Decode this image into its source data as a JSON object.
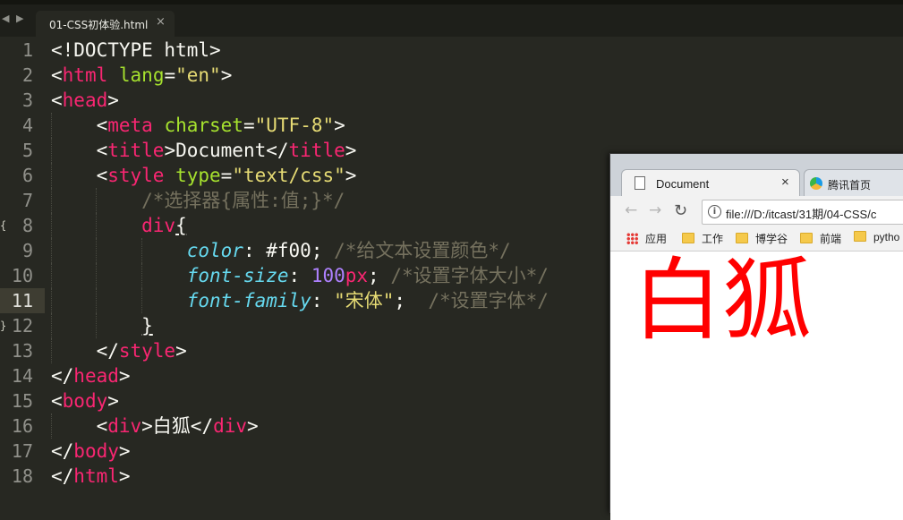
{
  "editor": {
    "tab_title": "01-CSS初体验.html",
    "nav_arrows": "◀ ▶",
    "close_glyph": "×",
    "lines": [
      {
        "n": "1",
        "tokens": [
          [
            "p0",
            "<!DOCTYPE html>"
          ]
        ]
      },
      {
        "n": "2",
        "tokens": [
          [
            "p0",
            "<"
          ],
          [
            "t",
            "html"
          ],
          [
            "p0",
            " "
          ],
          [
            "a",
            "lang"
          ],
          [
            "p0",
            "="
          ],
          [
            "s",
            "\"en\""
          ],
          [
            "p0",
            ">"
          ]
        ]
      },
      {
        "n": "3",
        "tokens": [
          [
            "p0",
            "<"
          ],
          [
            "t",
            "head"
          ],
          [
            "p0",
            ">"
          ]
        ]
      },
      {
        "n": "4",
        "tokens": [
          [
            "p0",
            "    <"
          ],
          [
            "t",
            "meta"
          ],
          [
            "p0",
            " "
          ],
          [
            "a",
            "charset"
          ],
          [
            "p0",
            "="
          ],
          [
            "s",
            "\"UTF-8\""
          ],
          [
            "p0",
            ">"
          ]
        ]
      },
      {
        "n": "5",
        "tokens": [
          [
            "p0",
            "    <"
          ],
          [
            "t",
            "title"
          ],
          [
            "p0",
            ">Document</"
          ],
          [
            "t",
            "title"
          ],
          [
            "p0",
            ">"
          ]
        ]
      },
      {
        "n": "6",
        "tokens": [
          [
            "p0",
            "    <"
          ],
          [
            "t",
            "style"
          ],
          [
            "p0",
            " "
          ],
          [
            "a",
            "type"
          ],
          [
            "p0",
            "="
          ],
          [
            "s",
            "\"text/css\""
          ],
          [
            "p0",
            ">"
          ]
        ]
      },
      {
        "n": "7",
        "tokens": [
          [
            "c",
            "        /*选择器{属性:值;}*/"
          ]
        ]
      },
      {
        "n": "8",
        "tokens": [
          [
            "t",
            "        div"
          ],
          [
            "u",
            "{"
          ]
        ]
      },
      {
        "n": "9",
        "tokens": [
          [
            "p0",
            "            "
          ],
          [
            "p",
            "color"
          ],
          [
            "p0",
            ": "
          ],
          [
            "p0",
            "#f00; "
          ],
          [
            "c",
            "/*给文本设置颜色*/"
          ]
        ]
      },
      {
        "n": "10",
        "tokens": [
          [
            "p0",
            "            "
          ],
          [
            "p",
            "font-size"
          ],
          [
            "p0",
            ": "
          ],
          [
            "n",
            "100"
          ],
          [
            "t",
            "px"
          ],
          [
            "p0",
            "; "
          ],
          [
            "c",
            "/*设置字体大小*/"
          ]
        ]
      },
      {
        "n": "11",
        "tokens": [
          [
            "p0",
            "            "
          ],
          [
            "p",
            "font-family"
          ],
          [
            "p0",
            ": "
          ],
          [
            "s",
            "\"宋体\""
          ],
          [
            "p0",
            ";  "
          ],
          [
            "c",
            "/*设置字体*/"
          ]
        ]
      },
      {
        "n": "12",
        "tokens": [
          [
            "p0",
            "        "
          ],
          [
            "u",
            "}"
          ]
        ]
      },
      {
        "n": "13",
        "tokens": [
          [
            "p0",
            "    </"
          ],
          [
            "t",
            "style"
          ],
          [
            "p0",
            ">"
          ]
        ]
      },
      {
        "n": "14",
        "tokens": [
          [
            "p0",
            "</"
          ],
          [
            "t",
            "head"
          ],
          [
            "p0",
            ">"
          ]
        ]
      },
      {
        "n": "15",
        "tokens": [
          [
            "p0",
            "<"
          ],
          [
            "t",
            "body"
          ],
          [
            "p0",
            ">"
          ]
        ]
      },
      {
        "n": "16",
        "tokens": [
          [
            "p0",
            "    <"
          ],
          [
            "t",
            "div"
          ],
          [
            "p0",
            ">白狐</"
          ],
          [
            "t",
            "div"
          ],
          [
            "p0",
            ">"
          ]
        ]
      },
      {
        "n": "17",
        "tokens": [
          [
            "p0",
            "</"
          ],
          [
            "t",
            "body"
          ],
          [
            "p0",
            ">"
          ]
        ]
      },
      {
        "n": "18",
        "tokens": [
          [
            "p0",
            "</"
          ],
          [
            "t",
            "html"
          ],
          [
            "p0",
            ">"
          ]
        ]
      }
    ]
  },
  "browser": {
    "tab_title": "Document",
    "tab_close": "×",
    "tab2_title": "腾讯首页",
    "back": "←",
    "forward": "→",
    "reload": "↻",
    "info_glyph": "i",
    "url": "file:///D:/itcast/31期/04-CSS/c",
    "bookmarks": [
      {
        "label": "应用",
        "kind": "apps"
      },
      {
        "label": "工作",
        "kind": "folder"
      },
      {
        "label": "博学谷",
        "kind": "folder"
      },
      {
        "label": "前端",
        "kind": "folder"
      },
      {
        "label": "pytho",
        "kind": "folder"
      }
    ],
    "page_text": "白狐",
    "page_text_color": "#ff0000"
  },
  "theme": {
    "background": "#272822",
    "tag": "#f92672",
    "attr": "#a6e22e",
    "string": "#e6db74",
    "property": "#66d9ef",
    "comment": "#75715e",
    "number": "#ae81ff"
  }
}
